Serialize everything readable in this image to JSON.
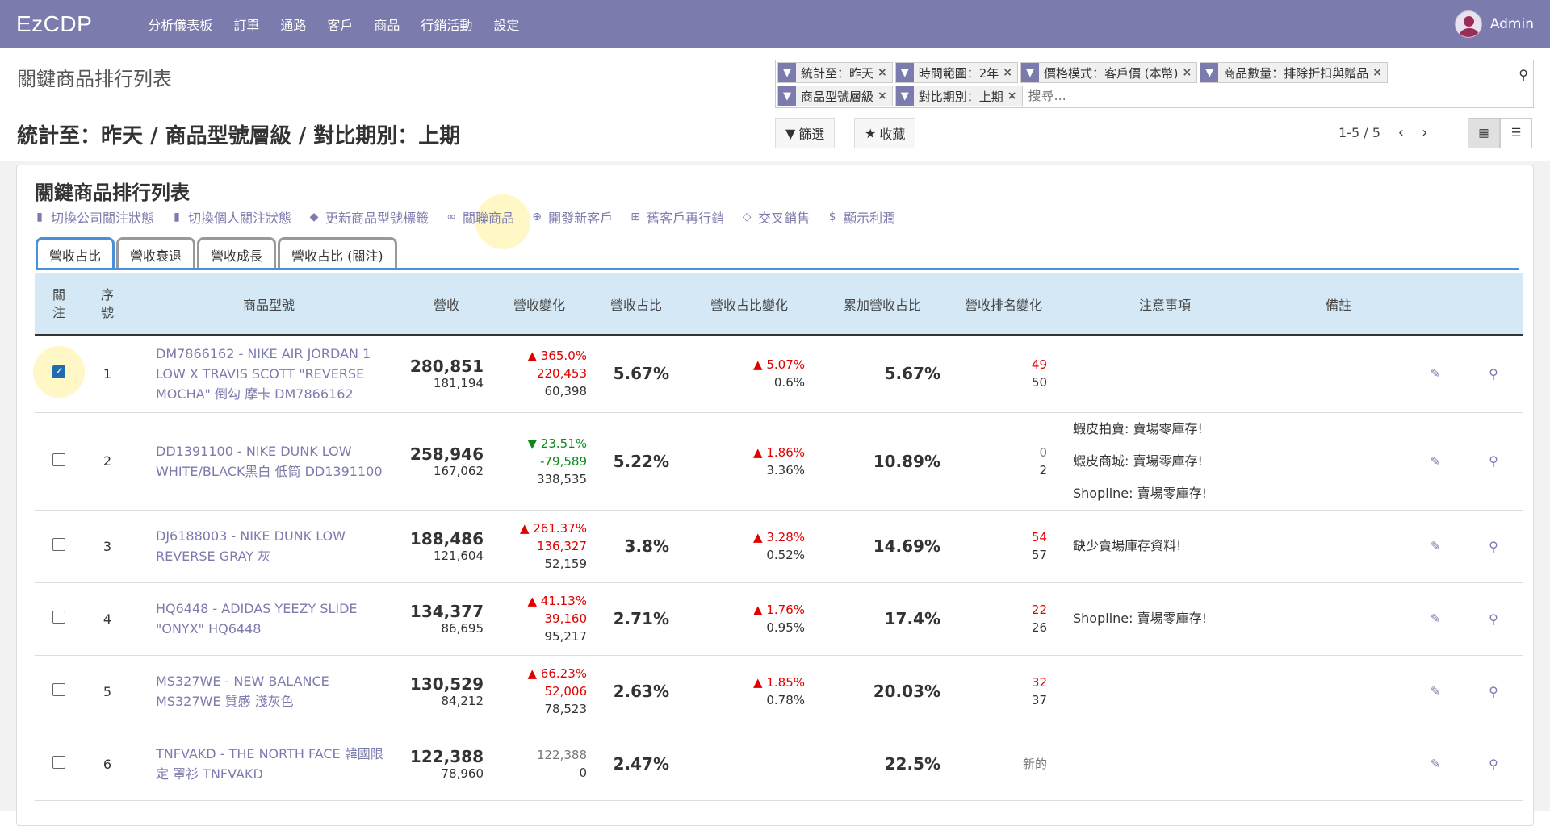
{
  "app": {
    "brand": "EzCDP",
    "user": "Admin"
  },
  "menu": [
    "分析儀表板",
    "訂單",
    "通路",
    "客戶",
    "商品",
    "行銷活動",
    "設定"
  ],
  "control": {
    "title": "關鍵商品排行列表",
    "subtitle": "統計至：昨天 / 商品型號層級 / 對比期別：上期",
    "facets_row1": [
      "統計至：昨天",
      "時間範圍：2年",
      "價格模式：客戶價 (本幣)",
      "商品數量：排除折扣與贈品"
    ],
    "facets_row2": [
      "商品型號層級",
      "對比期別：上期"
    ],
    "search_placeholder": "搜尋...",
    "filter_label": "篩選",
    "favorite_label": "收藏",
    "pager": "1-5 / 5"
  },
  "card": {
    "title": "關鍵商品排行列表",
    "actions": [
      {
        "label": "切換公司關注狀態",
        "icon": "bookmark-icon"
      },
      {
        "label": "切換個人關注狀態",
        "icon": "bookmark-icon"
      },
      {
        "label": "更新商品型號標籤",
        "icon": "tag-icon"
      },
      {
        "label": "關聯商品",
        "icon": "link-icon"
      },
      {
        "label": "開發新客戶",
        "icon": "user-plus-icon"
      },
      {
        "label": "舊客戶再行銷",
        "icon": "cart-icon"
      },
      {
        "label": "交叉銷售",
        "icon": "exchange-icon"
      },
      {
        "label": "顯示利潤",
        "icon": "dollar-icon"
      }
    ],
    "tabs": [
      "營收占比",
      "營收衰退",
      "營收成長",
      "營收占比 (關注)"
    ]
  },
  "table": {
    "headers": [
      "關注",
      "序號",
      "商品型號",
      "營收",
      "營收變化",
      "營收占比",
      "營收占比變化",
      "累加營收占比",
      "營收排名變化",
      "注意事項",
      "備註"
    ],
    "rows": [
      {
        "no": "1",
        "checked": true,
        "product": "DM7866162 - NIKE AIR JORDAN 1 LOW X TRAVIS SCOTT \"REVERSE MOCHA\" 倒勾 摩卡 DM7866162",
        "rev": "280,851",
        "rev_prev": "181,194",
        "chg_pct": "▲ 365.0%",
        "chg_amt": "220,453",
        "chg_base": "60,398",
        "dir": "up",
        "share": "5.67%",
        "share_chg": "▲ 5.07%",
        "share_prev": "0.6%",
        "share_dir": "up",
        "cum": "5.67%",
        "rank_new": "49",
        "rank_old": "50",
        "rank_dir": "up",
        "notes": []
      },
      {
        "no": "2",
        "checked": false,
        "product": "DD1391100 - NIKE DUNK LOW WHITE/BLACK黑白 低筒 DD1391100",
        "rev": "258,946",
        "rev_prev": "167,062",
        "chg_pct": "▼ 23.51%",
        "chg_amt": "-79,589",
        "chg_base": "338,535",
        "dir": "down",
        "share": "5.22%",
        "share_chg": "▲ 1.86%",
        "share_prev": "3.36%",
        "share_dir": "up",
        "cum": "10.89%",
        "rank_new": "0",
        "rank_old": "2",
        "rank_dir": "none",
        "notes": [
          "蝦皮拍賣: 賣場零庫存!",
          "蝦皮商城: 賣場零庫存!",
          "Shopline: 賣場零庫存!"
        ]
      },
      {
        "no": "3",
        "checked": false,
        "product": "DJ6188003 - NIKE DUNK LOW REVERSE GRAY 灰",
        "rev": "188,486",
        "rev_prev": "121,604",
        "chg_pct": "▲ 261.37%",
        "chg_amt": "136,327",
        "chg_base": "52,159",
        "dir": "up",
        "share": "3.8%",
        "share_chg": "▲ 3.28%",
        "share_prev": "0.52%",
        "share_dir": "up",
        "cum": "14.69%",
        "rank_new": "54",
        "rank_old": "57",
        "rank_dir": "up",
        "notes": [
          "缺少賣場庫存資料!"
        ]
      },
      {
        "no": "4",
        "checked": false,
        "product": "HQ6448 - ADIDAS YEEZY SLIDE \"ONYX\" HQ6448",
        "rev": "134,377",
        "rev_prev": "86,695",
        "chg_pct": "▲ 41.13%",
        "chg_amt": "39,160",
        "chg_base": "95,217",
        "dir": "up",
        "share": "2.71%",
        "share_chg": "▲ 1.76%",
        "share_prev": "0.95%",
        "share_dir": "up",
        "cum": "17.4%",
        "rank_new": "22",
        "rank_old": "26",
        "rank_dir": "up",
        "notes": [
          "Shopline: 賣場零庫存!"
        ]
      },
      {
        "no": "5",
        "checked": false,
        "product": "MS327WE - NEW BALANCE MS327WE 質感 淺灰色",
        "rev": "130,529",
        "rev_prev": "84,212",
        "chg_pct": "▲ 66.23%",
        "chg_amt": "52,006",
        "chg_base": "78,523",
        "dir": "up",
        "share": "2.63%",
        "share_chg": "▲ 1.85%",
        "share_prev": "0.78%",
        "share_dir": "up",
        "cum": "20.03%",
        "rank_new": "32",
        "rank_old": "37",
        "rank_dir": "up",
        "notes": []
      },
      {
        "no": "6",
        "checked": false,
        "product": "TNFVAKD - THE NORTH FACE 韓國限定 罩衫 TNFVAKD",
        "rev": "122,388",
        "rev_prev": "78,960",
        "chg_pct": "",
        "chg_amt": "122,388",
        "chg_base": "0",
        "dir": "none",
        "share": "2.47%",
        "share_chg": "",
        "share_prev": "",
        "share_dir": "none",
        "cum": "22.5%",
        "rank_new": "新的",
        "rank_old": "",
        "rank_dir": "none",
        "notes": []
      }
    ]
  }
}
